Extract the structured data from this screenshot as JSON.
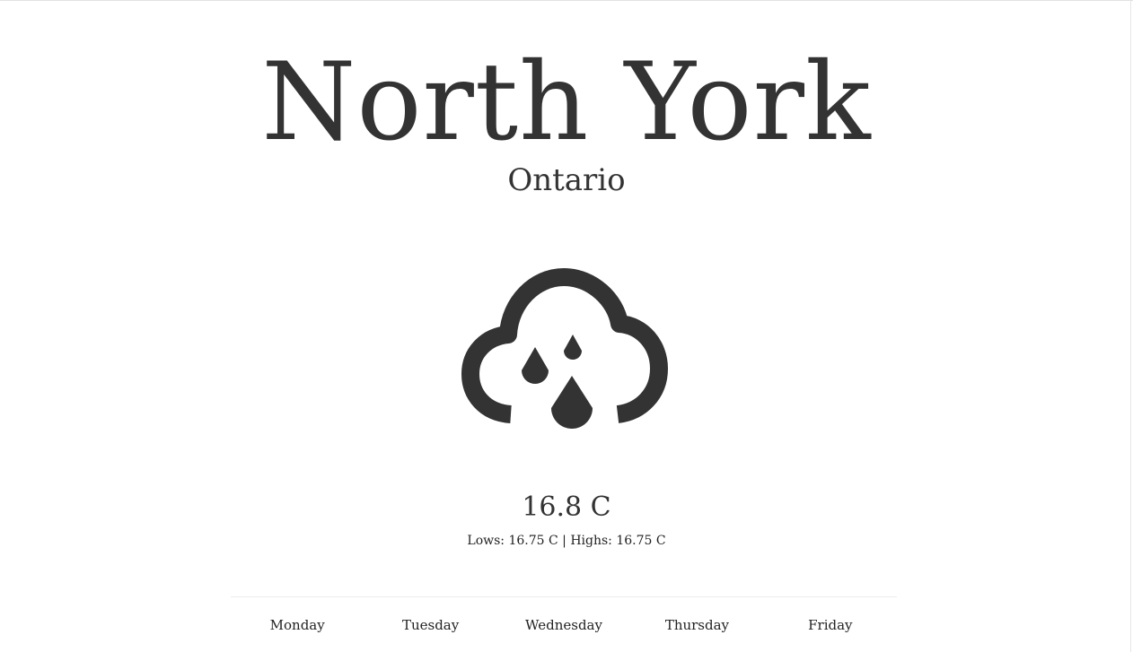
{
  "location": {
    "city": "North York",
    "region": "Ontario"
  },
  "current": {
    "icon": "rain-cloud-icon",
    "temperature": "16.8 C",
    "range": "Lows: 16.75 C | Highs: 16.75 C"
  },
  "forecast": {
    "days": [
      "Monday",
      "Tuesday",
      "Wednesday",
      "Thursday",
      "Friday"
    ]
  },
  "colors": {
    "text": "#333333",
    "background": "#ffffff"
  }
}
